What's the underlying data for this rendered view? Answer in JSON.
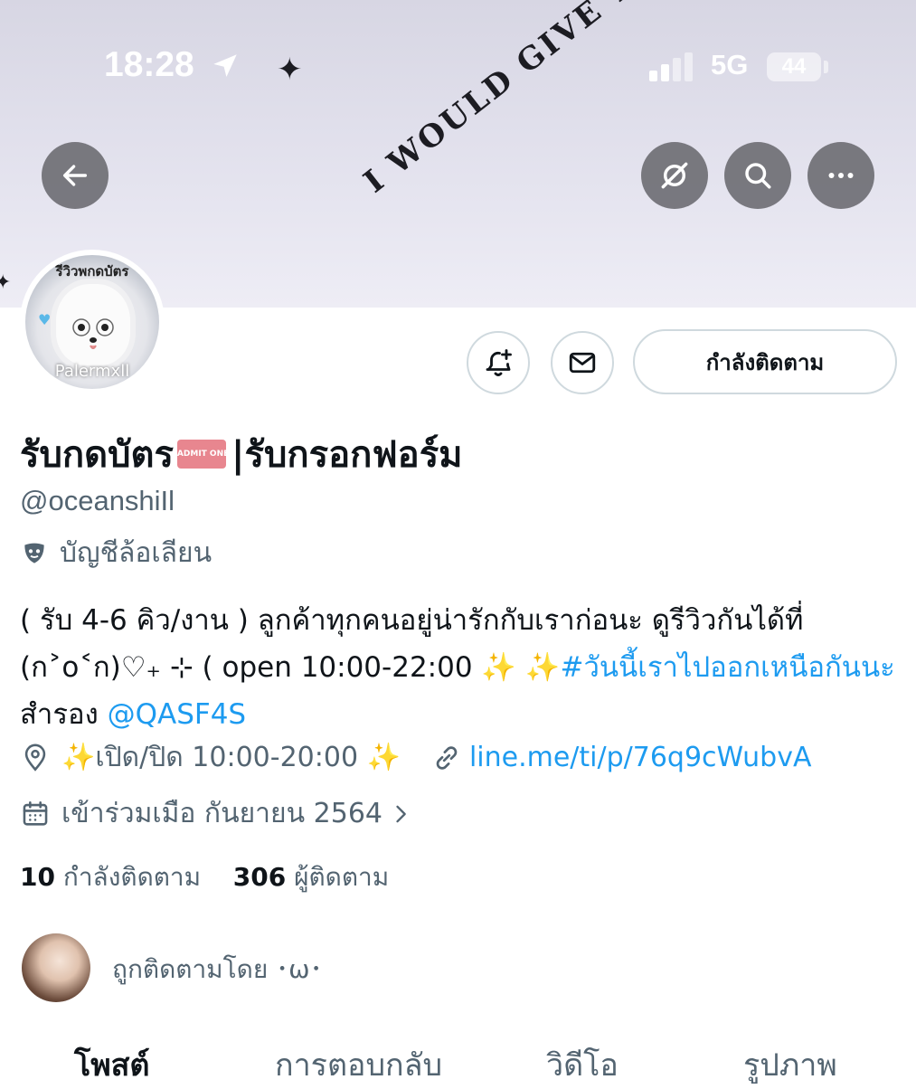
{
  "status_bar": {
    "time": "18:28",
    "network": "5G",
    "battery": "44"
  },
  "banner": {
    "text": "I WOULD GIVE YOU"
  },
  "header_buttons": {
    "back": "back-arrow-icon",
    "hide": "eye-slash-icon",
    "search": "search-icon",
    "more": "more-icon"
  },
  "avatar": {
    "label": "รีวิวพกดบัตร",
    "sub": "Palermxll"
  },
  "actions": {
    "following_label": "กำลังติดตาม"
  },
  "profile": {
    "name_part1": "รับกดบัตร",
    "ticket_text": "ADMIT ONE",
    "name_part2": "|รับกรอกฟอร์ม",
    "handle": "@oceanshiIl",
    "parody_label": "บัญชีล้อเลียน"
  },
  "bio": {
    "line1": "( รับ 4-6 คิว/งาน ) ลูกค้าทุกคนอยู่น่ารักกับเราก่อนะ ดูรีวิวกันได้ที่",
    "line2_text": "(ก˃o˂ก)♡₊ ⊹ ( open 10:00-22:00 ✨ ",
    "hashtag": "✨#วันนี้เราไปออกเหนือกันนะ",
    "reserve_text": " สำรอง ",
    "mention": "@QASF4S"
  },
  "meta": {
    "location": "✨เปิด/ปิด 10:00-20:00 ✨",
    "url": "line.me/ti/p/76q9cWubvA",
    "joined": "เข้าร่วมเมือ กันยายน 2564"
  },
  "stats": {
    "following_count": "10",
    "following_label": "กำลังติดตาม",
    "followers_count": "306",
    "followers_label": "ผู้ติดตาม"
  },
  "followed_by": "ถูกติดตามโดย ･ω･",
  "tabs": [
    "โพสต์",
    "การตอบกลับ",
    "วิดีโอ",
    "รูปภาพ"
  ],
  "colors": {
    "link": "#1d9bf0",
    "secondary_text": "#536471",
    "primary_text": "#0f1419"
  }
}
